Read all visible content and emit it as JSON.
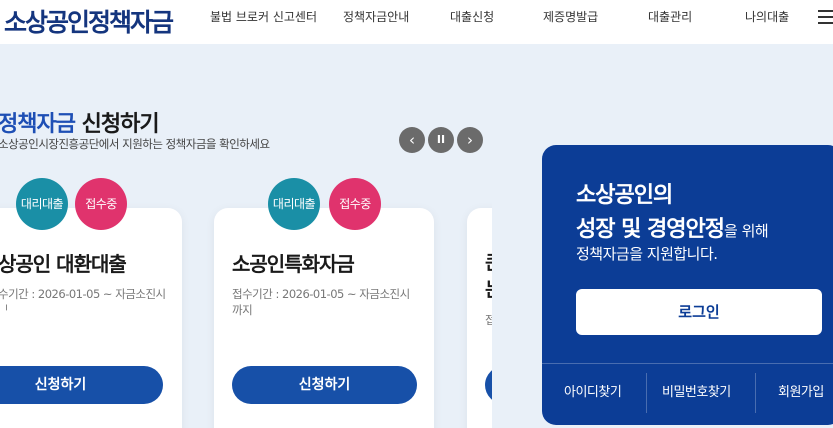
{
  "header": {
    "logo": "소상공인정책자금",
    "nav": [
      "불법 브로커 신고센터",
      "정책자금안내",
      "대출신청",
      "제증명발급",
      "대출관리",
      "나의대출"
    ]
  },
  "section": {
    "title_highlight": "정책자금",
    "title_rest": " 신청하기",
    "subtitle": "소상공인시장진흥공단에서 지원하는 정책자금을 확인하세요"
  },
  "carousel": {
    "prev": "‹",
    "pause": "II",
    "next": "›"
  },
  "cards": [
    {
      "badge1": "대리대출",
      "badge2": "접수중",
      "title": "상공인 대환대출",
      "period": "수기간 : 2026-01-05 ~ 자금소진시",
      "period2": "ᅵ",
      "button": "신청하기"
    },
    {
      "badge1": "대리대출",
      "badge2": "접수중",
      "title": "소공인특화자금",
      "period": "접수기간 : 2026-01-05 ~ 자금소진시",
      "period2": "까지",
      "button": "신청하기"
    },
    {
      "title": "큰",
      "title2": "는",
      "period": "접",
      "button": ""
    }
  ],
  "login_panel": {
    "line1": "소상공인의",
    "line2": "성장 및 경영안정",
    "line2_small": "을 위해",
    "line3": "정책자금을 지원합니다.",
    "login_button": "로그인",
    "links": [
      "아이디찾기",
      "비밀번호찾기",
      "회원가입"
    ]
  }
}
